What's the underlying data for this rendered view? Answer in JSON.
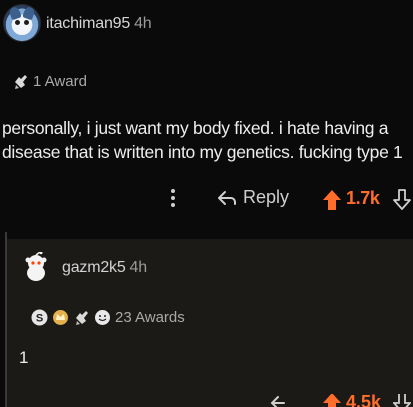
{
  "comment1": {
    "username": "itachiman95",
    "time": "4h",
    "award_count": "1 Award",
    "body": "personally, i just want my body fixed. i hate having a disease that is written into my genetics. fucking type 1",
    "reply_label": "Reply",
    "score": "1.7k"
  },
  "comment2": {
    "username": "gazm2k5",
    "time": "4h",
    "award_count": "23 Awards",
    "body": "1",
    "score": "4.5k"
  },
  "colors": {
    "upvote": "#ff6d2a",
    "background": "#0a0a0b",
    "reply_bg": "#1b1a17"
  },
  "icons": [
    "more-dots-icon",
    "reply-arrow-icon",
    "upvote-arrow-icon",
    "downvote-arrow-icon",
    "award-icon"
  ]
}
